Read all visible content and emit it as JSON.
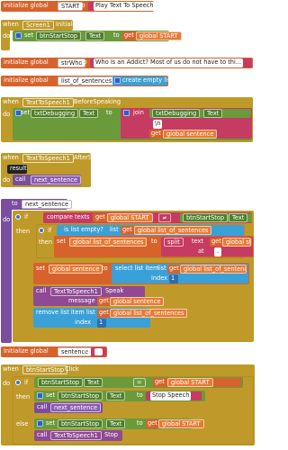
{
  "blocks": {
    "b1": {
      "init": "initialize global",
      "name": "START",
      "to": "to",
      "value": "Play Text To Speech"
    },
    "b2": {
      "when": "when",
      "component": "Screen1",
      "event": "Initialize",
      "do": "do",
      "set": "set",
      "target": "btnStartStop",
      "prop": "Text",
      "to": "to",
      "get": "get",
      "var": "global START"
    },
    "b3": {
      "init": "initialize global",
      "name": "strWho",
      "to": "to",
      "value": "Who Is an Addict? Most of us do not have to thi..."
    },
    "b4": {
      "init": "initialize global",
      "name": "list_of_sentences",
      "to": "to",
      "value": "create empty list"
    },
    "b5": {
      "when": "when",
      "component": "TextToSpeech1",
      "event": "BeforeSpeaking",
      "do": "do",
      "set": "set",
      "target": "txtDebugging",
      "prop": "Text",
      "to": "to",
      "join": "join",
      "arg1_comp": "txtDebugging",
      "arg1_prop": "Text",
      "arg2": "\\n",
      "get": "get",
      "arg3": "global sentence"
    },
    "b6": {
      "when": "when",
      "component": "TextToSpeech1",
      "event": "AfterSpeaking",
      "result": "result",
      "do": "do",
      "call": "call",
      "proc": "next_sentence"
    },
    "b7": {
      "to": "to",
      "proc": "next_sentence",
      "do": "do",
      "if": "if",
      "compare": "compare texts",
      "get": "get",
      "var1": "global START",
      "op": "≠",
      "comp": "btnStartStop",
      "prop": "Text",
      "then": "then",
      "if2": "if",
      "isempty": "is list empty?",
      "list": "list",
      "var2": "global list_of_sentences",
      "then2": "then",
      "set": "set",
      "var3": "global list_of_sentences",
      "split": "split",
      "text": "text",
      "var4": "global strWho",
      "at": "at",
      "atval": ".",
      "set2": "set",
      "var5": "global sentence",
      "select": "select list item",
      "list_lbl": "list",
      "var6": "global list_of_sentences",
      "index": "index",
      "idx": "1",
      "call": "call",
      "tts": "TextToSpeech1",
      "speak": "Speak",
      "message": "message",
      "var7": "global sentence",
      "remove": "remove list item",
      "list2": "list",
      "var8": "global list_of_sentences",
      "index2": "index",
      "idx2": "1"
    },
    "b8": {
      "init": "initialize global",
      "name": "sentence",
      "to": "to",
      "value": ""
    },
    "b9": {
      "when": "when",
      "component": "btnStartStop",
      "event": "Click",
      "do": "do",
      "if": "if",
      "comp": "btnStartStop",
      "prop": "Text",
      "op": "=",
      "get": "get",
      "var": "global START",
      "then": "then",
      "set": "set",
      "comp2": "btnStartStop",
      "prop2": "Text",
      "to": "to",
      "stop": "Stop Speech",
      "call": "call",
      "proc": "next_sentence",
      "else": "else",
      "set2": "set",
      "comp3": "btnStartStop",
      "prop3": "Text",
      "to2": "to",
      "get2": "get",
      "var2": "global START",
      "call2": "call",
      "tts": "TextToSpeech1",
      "stop_m": "Stop"
    }
  },
  "colors": {
    "variable": "#d8622b",
    "event": "#bf9a2a",
    "component": "#6b9a3b",
    "text": "#c63b62",
    "list": "#3aa0d8",
    "procedure": "#7b4d9e",
    "control": "#bf9a2a"
  }
}
